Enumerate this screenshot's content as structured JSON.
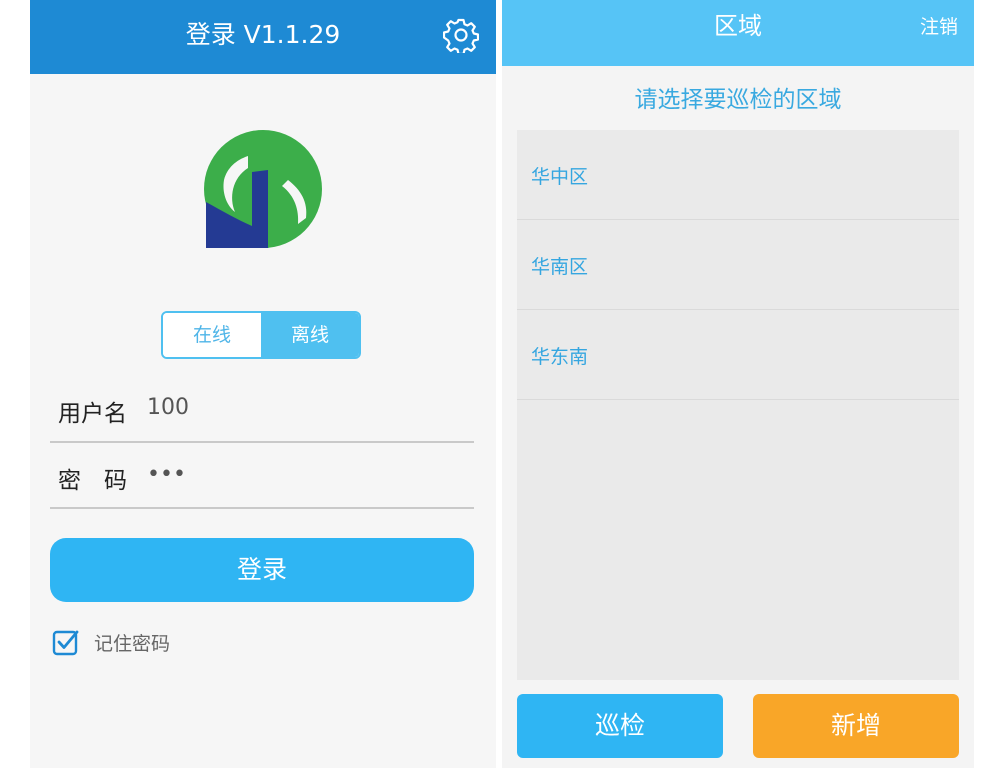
{
  "login": {
    "title": "登录 V1.1.29",
    "settings_icon": "gear-icon",
    "logo_colors": {
      "green": "#3cae4a",
      "navy": "#243a93"
    },
    "mode_toggle": {
      "online": "在线",
      "offline": "离线",
      "selected": "离线"
    },
    "username_label": "用户名",
    "username_value": "100",
    "password_label": "密　码",
    "password_value": "•••",
    "submit_label": "登录",
    "remember_label": "记住密码",
    "remember_checked": true,
    "colors": {
      "header": "#1e8ad4",
      "button": "#2fb5f3",
      "toggle": "#4fc0f0"
    }
  },
  "region": {
    "title": "区域",
    "logout_label": "注销",
    "prompt": "请选择要巡检的区域",
    "items": [
      {
        "label": "华中区"
      },
      {
        "label": "华南区"
      },
      {
        "label": "华东南"
      }
    ],
    "patrol_label": "巡检",
    "add_label": "新增",
    "colors": {
      "header": "#56c4f6",
      "patrol": "#2fb5f3",
      "add": "#f9a628",
      "text": "#35a6e0"
    }
  }
}
